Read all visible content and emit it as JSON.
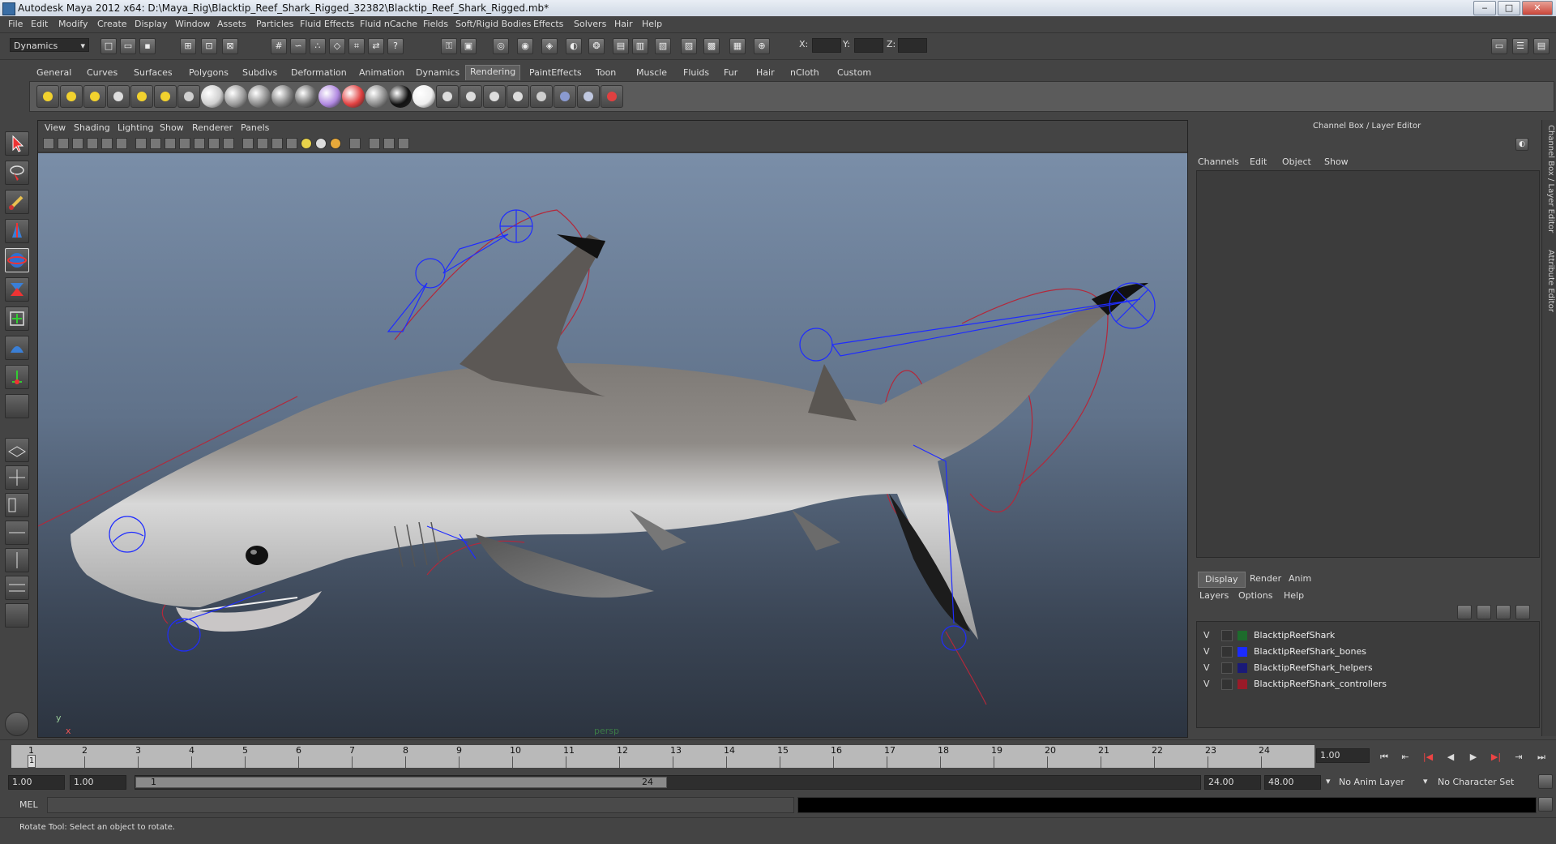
{
  "window": {
    "title": "Autodesk Maya 2012 x64: D:\\Maya_Rig\\Blacktip_Reef_Shark_Rigged_32382\\Blacktip_Reef_Shark_Rigged.mb*",
    "minimize": "‒",
    "maximize": "□",
    "close": "✕"
  },
  "menubar": [
    "File",
    "Edit",
    "Modify",
    "Create",
    "Display",
    "Window",
    "Assets",
    "Particles",
    "Fluid Effects",
    "Fluid nCache",
    "Fields",
    "Soft/Rigid Bodies",
    "Effects",
    "Solvers",
    "Hair",
    "Help"
  ],
  "statusline": {
    "menuset": "Dynamics",
    "x_label": "X:",
    "y_label": "Y:",
    "z_label": "Z:"
  },
  "shelf": {
    "tabs": [
      "General",
      "Curves",
      "Surfaces",
      "Polygons",
      "Subdivs",
      "Deformation",
      "Animation",
      "Dynamics",
      "Rendering",
      "PaintEffects",
      "Toon",
      "Muscle",
      "Fluids",
      "Fur",
      "Hair",
      "nCloth",
      "Custom"
    ],
    "active_tab": "Rendering",
    "icons": [
      "ambient-light-icon",
      "directional-light-icon",
      "point-light-icon",
      "spot-light-icon",
      "area-light-icon",
      "volume-light-icon",
      "render-settings-icon",
      "lambert-sphere-icon",
      "blinn-sphere-icon",
      "phong-sphere-icon",
      "phonge-sphere-icon",
      "anisotropic-sphere-icon",
      "ramp-sphere-icon",
      "layered-sphere-icon",
      "gray-sphere-icon",
      "black-sphere-icon",
      "white-circle-icon",
      "render-current-icon",
      "ipr-render-icon",
      "batch-render-icon",
      "render-view-icon",
      "hypershade-icon",
      "render-globals-icon",
      "mental-ray-icon",
      "paint-brush-icon"
    ]
  },
  "viewport": {
    "menu": [
      "View",
      "Shading",
      "Lighting",
      "Show",
      "Renderer",
      "Panels"
    ],
    "camera_label": "persp",
    "axis_y": "y",
    "axis_x": "x"
  },
  "channelbox": {
    "title": "Channel Box / Layer Editor",
    "menu": [
      "Channels",
      "Edit",
      "Object",
      "Show"
    ]
  },
  "layers": {
    "tabs": [
      "Display",
      "Render",
      "Anim"
    ],
    "active_tab": "Display",
    "menu": [
      "Layers",
      "Options",
      "Help"
    ],
    "items": [
      {
        "visible": "V",
        "name": "BlacktipReefShark",
        "color": "#1d6b2c"
      },
      {
        "visible": "V",
        "name": "BlacktipReefShark_bones",
        "color": "#1b2bff"
      },
      {
        "visible": "V",
        "name": "BlacktipReefShark_helpers",
        "color": "#1a1a78"
      },
      {
        "visible": "V",
        "name": "BlacktipReefShark_controllers",
        "color": "#9a1a28"
      }
    ]
  },
  "sidetabs": [
    "Channel Box / Layer Editor",
    "Attribute Editor"
  ],
  "timeline": {
    "ticks": [
      "1",
      "2",
      "3",
      "4",
      "5",
      "6",
      "7",
      "8",
      "9",
      "10",
      "11",
      "12",
      "13",
      "14",
      "15",
      "16",
      "17",
      "18",
      "19",
      "20",
      "21",
      "22",
      "23",
      "24"
    ],
    "current_frame_marker": "1",
    "current_time": "1.00",
    "playback_controls": [
      "⏮",
      "⇤",
      "|◀",
      "◀",
      "▶",
      "▶|",
      "⇥",
      "⏭"
    ]
  },
  "range": {
    "start_time": "1.00",
    "playback_start": "1.00",
    "slider_start": "1",
    "slider_end": "24",
    "playback_end": "24.00",
    "end_time": "48.00",
    "anim_layer": "No Anim Layer",
    "character_set": "No Character Set"
  },
  "command": {
    "label": "MEL"
  },
  "help": {
    "text": "Rotate Tool: Select an object to rotate."
  }
}
